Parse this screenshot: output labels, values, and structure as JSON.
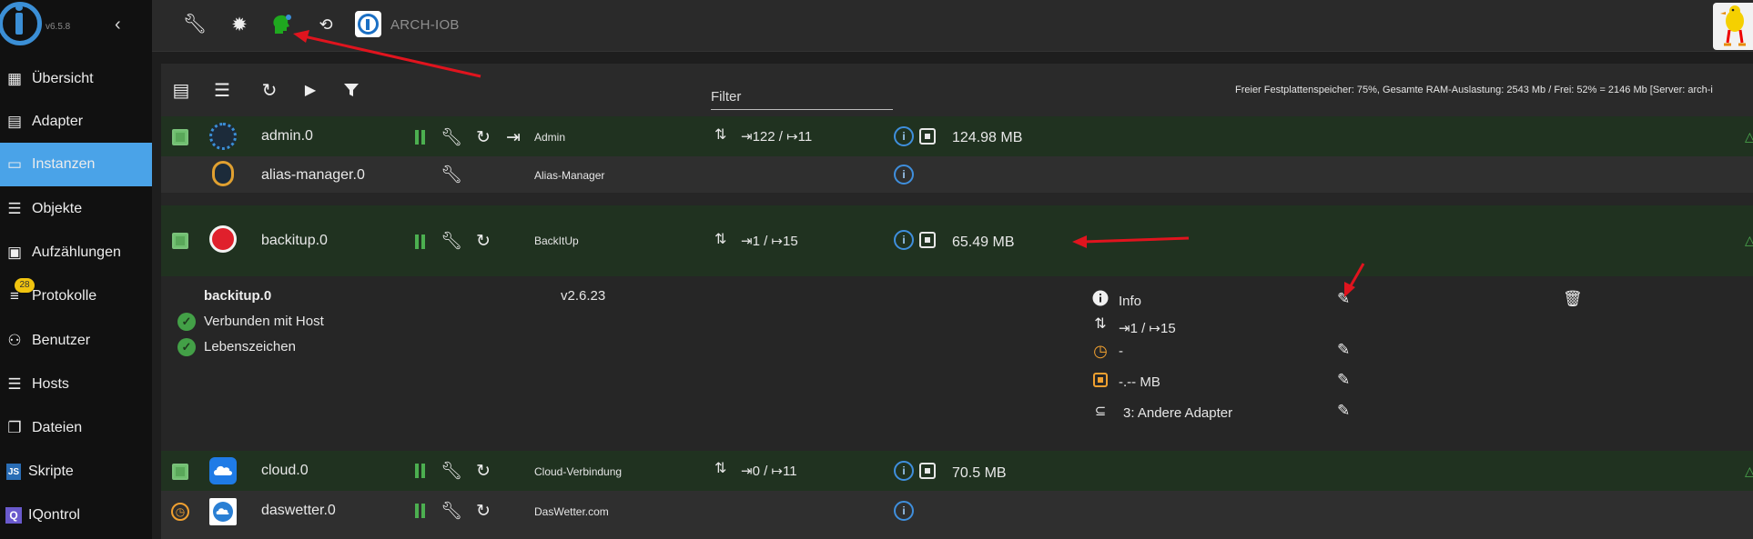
{
  "sidebar": {
    "version": "v6.5.8",
    "items": [
      {
        "label": "Übersicht",
        "icon": "grid-icon"
      },
      {
        "label": "Adapter",
        "icon": "store-icon"
      },
      {
        "label": "Instanzen",
        "icon": "instances-icon",
        "active": true
      },
      {
        "label": "Objekte",
        "icon": "list-icon"
      },
      {
        "label": "Aufzählungen",
        "icon": "enum-icon"
      },
      {
        "label": "Protokolle",
        "icon": "log-icon",
        "badge": "28"
      },
      {
        "label": "Benutzer",
        "icon": "user-icon"
      },
      {
        "label": "Hosts",
        "icon": "hosts-icon"
      },
      {
        "label": "Dateien",
        "icon": "files-icon"
      },
      {
        "label": "Skripte",
        "icon": "js-icon"
      },
      {
        "label": "IQontrol",
        "icon": "iqontrol-icon"
      }
    ]
  },
  "topbar": {
    "title": "ARCH-IOB"
  },
  "toolbar": {
    "filter_label": "Filter",
    "system_info": "Freier Festplattenspeicher: 75%, Gesamte RAM-Auslastung: 2543 Mb / Frei: 52% = 2146 Mb [Server: arch-i"
  },
  "instances": [
    {
      "name": "admin.0",
      "title": "Admin",
      "events": "⇥122 / ↦11",
      "memory": "124.98 MB"
    },
    {
      "name": "alias-manager.0",
      "title": "Alias-Manager"
    },
    {
      "name": "backitup.0",
      "title": "BackItUp",
      "events": "⇥1 / ↦15",
      "memory": "65.49 MB"
    },
    {
      "name": "cloud.0",
      "title": "Cloud-Verbindung",
      "events": "⇥0 / ↦11",
      "memory": "70.5 MB"
    },
    {
      "name": "daswetter.0",
      "title": "DasWetter.com"
    }
  ],
  "detail": {
    "name": "backitup.0",
    "version": "v2.6.23",
    "connected": "Verbunden mit Host",
    "heartbeat": "Lebenszeichen",
    "info": "Info",
    "events": "⇥1 / ↦15",
    "schedule": "-",
    "ram": "-.-- MB",
    "tier": "3: Andere Adapter"
  },
  "colors": {
    "accent": "#4aa3e8",
    "row_green": "#203220",
    "ok": "#4caf50",
    "arrow": "#e0141e"
  }
}
